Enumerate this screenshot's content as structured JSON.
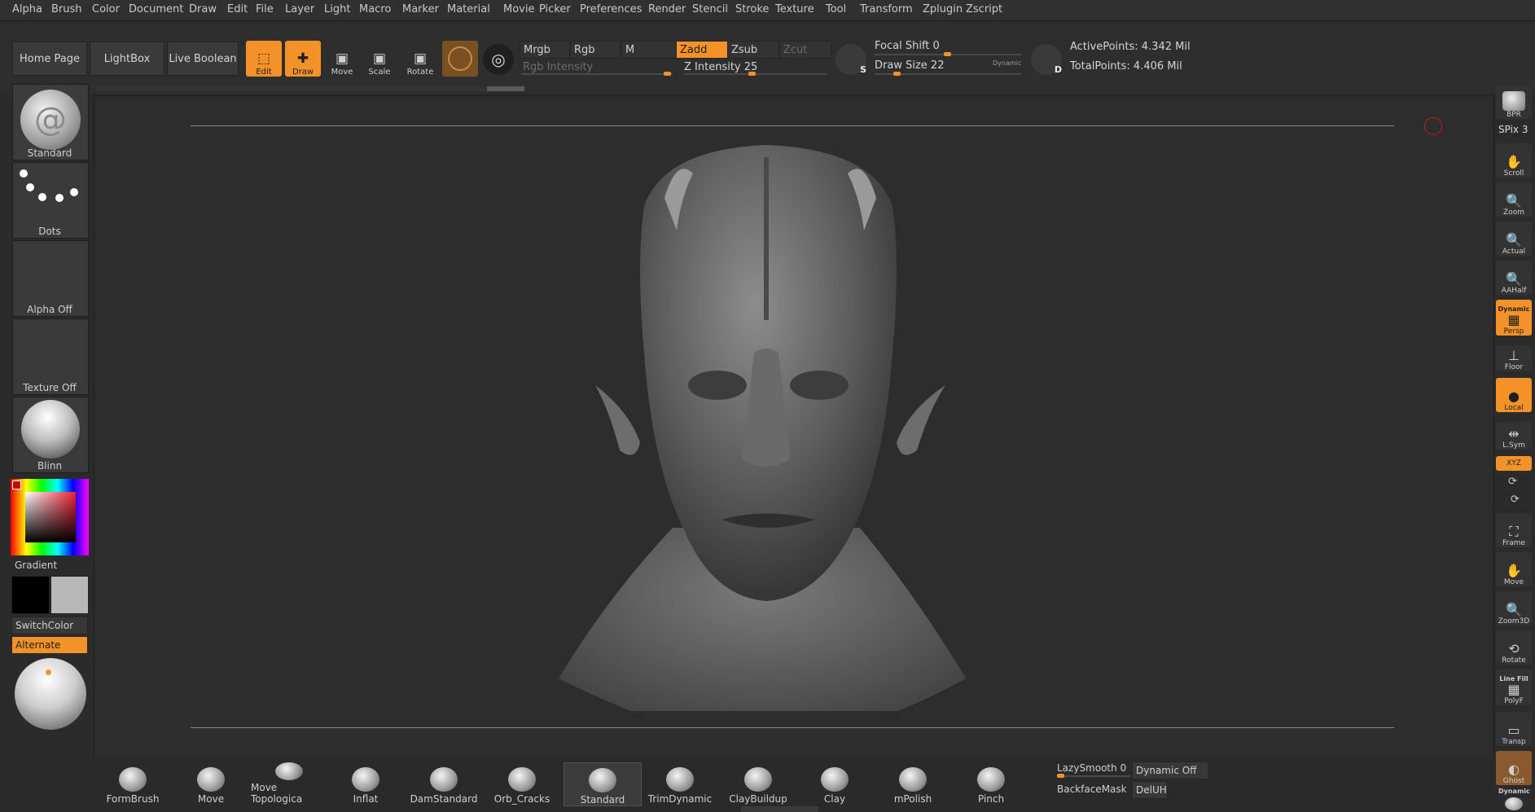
{
  "menu": [
    "Alpha",
    "Brush",
    "Color",
    "Document",
    "Draw",
    "Edit",
    "File",
    "Layer",
    "Light",
    "Macro",
    "Marker",
    "Material",
    "Movie",
    "Picker",
    "Preferences",
    "Render",
    "Stencil",
    "Stroke",
    "Texture",
    "Tool",
    "Transform",
    "Zplugin",
    "Zscript"
  ],
  "toolbar": {
    "home_page": "Home Page",
    "lightbox": "LightBox",
    "live_boolean": "Live Boolean",
    "edit": "Edit",
    "draw": "Draw",
    "move": "Move",
    "scale": "Scale",
    "rotate": "Rotate",
    "mrgb": "Mrgb",
    "rgb": "Rgb",
    "m": "M",
    "zadd": "Zadd",
    "zsub": "Zsub",
    "zcut": "Zcut",
    "rgb_intensity": "Rgb Intensity",
    "z_intensity_label": "Z Intensity",
    "z_intensity_value": "25",
    "focal_shift_label": "Focal Shift",
    "focal_shift_value": "0",
    "draw_size_label": "Draw Size",
    "draw_size_value": "22",
    "dynamic": "Dynamic",
    "s_key": "S",
    "d_key": "D",
    "active_points": "ActivePoints: 4.342 Mil",
    "total_points": "TotalPoints: 4.406 Mil"
  },
  "left_shelf": {
    "brush": "Standard",
    "stroke": "Dots",
    "alpha": "Alpha Off",
    "texture": "Texture Off",
    "material": "Blinn",
    "gradient": "Gradient",
    "switch_color": "SwitchColor",
    "alternate": "Alternate"
  },
  "right_shelf": {
    "bpr": "BPR",
    "spix": "SPix 3",
    "scroll": "Scroll",
    "zoom": "Zoom",
    "actual": "Actual",
    "aahalf": "AAHalf",
    "dynamic": "Dynamic",
    "persp": "Persp",
    "floor": "Floor",
    "local": "Local",
    "lsym": "L.Sym",
    "xyz": "XYZ",
    "frame": "Frame",
    "move": "Move",
    "zoom3d": "Zoom3D",
    "rotate": "Rotate",
    "line_fill": "Line Fill",
    "polyf": "PolyF",
    "transp": "Transp",
    "ghost": "Ghost",
    "dynamic2": "Dynamic"
  },
  "brushes": [
    "FormBrush",
    "Move",
    "Move Topologica",
    "Inflat",
    "DamStandard",
    "Orb_Cracks",
    "Standard",
    "TrimDynamic",
    "ClayBuildup",
    "Clay",
    "mPolish",
    "Pinch"
  ],
  "bottom_right": {
    "lazy_smooth": "LazySmooth 0",
    "dynamic_off": "Dynamic Off",
    "backface_mask": "BackfaceMask",
    "deluh": "DelUH"
  },
  "colors": {
    "accent": "#f4922a",
    "main_color": "#000000",
    "secondary_color": "#b8b8b8"
  }
}
